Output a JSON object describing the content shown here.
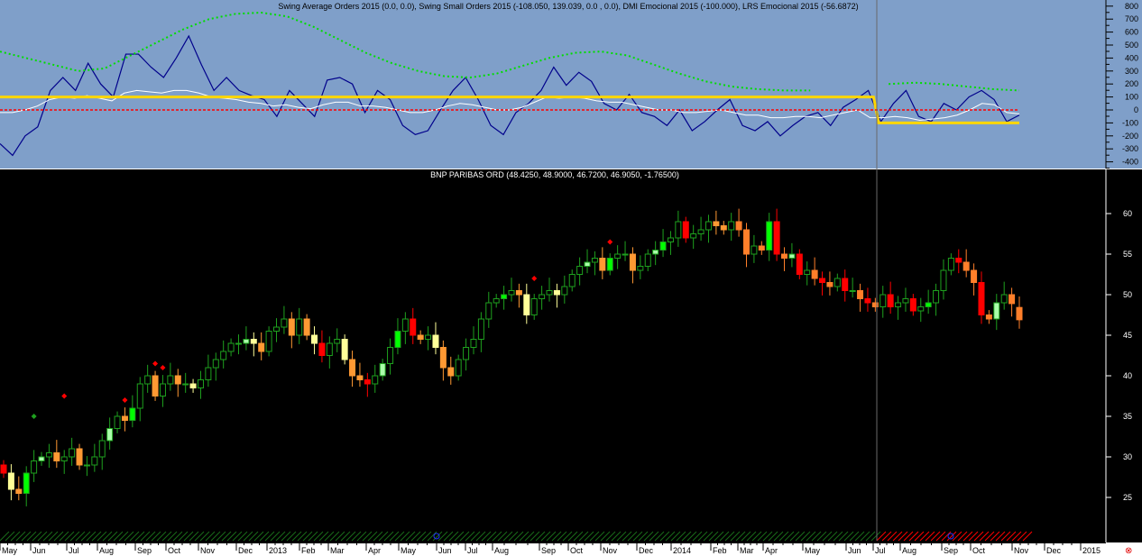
{
  "indicator_pane": {
    "title": "Swing Average Orders 2015 (0.0, 0.0), Swing Small Orders 2015 (-108.050, 139.039, 0.0 , 0.0), DMI Emocional 2015 (-100.000), LRS Emocional 2015 (-56.6872)",
    "y_ticks": [
      "800",
      "700",
      "600",
      "500",
      "400",
      "300",
      "200",
      "100",
      "0",
      "-100",
      "-200",
      "-300",
      "-400"
    ],
    "colors": {
      "background": "#7f9fc9",
      "blue": "#00008b",
      "white": "#ffffff",
      "green": "#00dd00",
      "yellow": "#ffd700",
      "red": "#ff0000"
    }
  },
  "price_pane": {
    "title": "BNP PARIBAS ORD (48.4250, 48.9000, 46.7200, 46.9050, -1.76500)",
    "y_ticks": [
      "60",
      "55",
      "50",
      "45",
      "40",
      "35",
      "30",
      "25"
    ]
  },
  "time_axis": {
    "labels": [
      "May",
      "Jun",
      "Jul",
      "Aug",
      "Sep",
      "Oct",
      "Nov",
      "Dec",
      "2013",
      "Feb",
      "Mar",
      "Apr",
      "May",
      "Jun",
      "Jul",
      "Aug",
      "Sep",
      "Oct",
      "Nov",
      "Dec",
      "2014",
      "Feb",
      "Mar",
      "Apr",
      "May",
      "Jun",
      "Jul",
      "Aug",
      "Sep",
      "Oct",
      "Nov",
      "Dec",
      "2015"
    ]
  },
  "corner_icon": "close-circle-icon",
  "chart_data": [
    {
      "type": "candlestick",
      "title": "BNP PARIBAS ORD",
      "period": "weekly",
      "ylim": [
        21,
        64
      ],
      "closes": [
        28,
        26,
        25.5,
        28,
        29.5,
        30,
        30.5,
        29.5,
        30,
        31,
        29,
        29,
        30,
        32,
        33.5,
        35,
        34.5,
        36,
        39,
        40,
        37.5,
        39,
        40,
        39,
        39,
        38.5,
        39.5,
        41,
        42,
        43,
        44,
        44,
        44.5,
        44,
        43,
        45.5,
        46,
        47,
        45,
        47,
        45,
        44,
        42.5,
        44,
        44.5,
        42,
        40,
        39.5,
        39,
        40,
        41.5,
        43.5,
        45.5,
        47,
        45,
        44.5,
        45,
        43.5,
        41,
        40,
        42,
        43.5,
        44.5,
        47,
        49,
        49.5,
        50,
        50.5,
        50,
        47.5,
        49.5,
        50,
        50.5,
        50,
        51,
        52.5,
        53.5,
        54,
        54.5,
        53,
        54.5,
        55,
        55,
        53,
        53.5,
        55,
        55.5,
        56.5,
        57,
        59,
        57,
        57.5,
        58,
        59,
        58.5,
        58,
        59,
        58,
        55,
        56,
        55.5,
        59,
        55,
        54.5,
        55,
        52.5,
        53,
        52,
        51.5,
        51,
        52,
        50.5,
        50.5,
        49.5,
        49,
        48.5,
        50,
        48.5,
        49,
        49.5,
        48,
        48.5,
        49,
        50.5,
        53,
        54.5,
        54,
        53,
        51.5,
        47.5,
        47,
        49,
        50,
        48.9,
        46.905
      ],
      "last_bar": {
        "open": 48.425,
        "high": 48.9,
        "low": 46.72,
        "close": 46.905,
        "change": -1.765
      }
    },
    {
      "type": "line",
      "title": "Indicators",
      "ylim": [
        -450,
        850
      ],
      "series": [
        {
          "name": "Swing Small Orders",
          "color": "#00008b",
          "values": [
            -260,
            -350,
            -200,
            -130,
            150,
            250,
            150,
            360,
            200,
            100,
            430,
            430,
            330,
            250,
            400,
            570,
            350,
            150,
            250,
            150,
            110,
            80,
            -50,
            150,
            50,
            -50,
            230,
            250,
            200,
            -20,
            150,
            80,
            -120,
            -190,
            -160,
            0,
            150,
            250,
            80,
            -120,
            -190,
            -20,
            50,
            150,
            330,
            190,
            290,
            220,
            50,
            0,
            120,
            -20,
            -50,
            -120,
            0,
            -160,
            -90,
            0,
            80,
            -120,
            -160,
            -90,
            -200,
            -120,
            -50,
            -20,
            -120,
            20,
            80,
            150,
            -90,
            50,
            150,
            -50,
            -90,
            50,
            0,
            100,
            150,
            80,
            -90,
            -40
          ]
        },
        {
          "name": "Swing Average Orders",
          "color": "#ffffff",
          "values": [
            -20,
            -20,
            0,
            30,
            80,
            100,
            90,
            110,
            90,
            70,
            130,
            150,
            140,
            130,
            150,
            150,
            130,
            100,
            90,
            80,
            60,
            50,
            30,
            40,
            20,
            10,
            40,
            60,
            60,
            30,
            30,
            20,
            0,
            -20,
            -20,
            0,
            30,
            50,
            40,
            20,
            0,
            0,
            20,
            60,
            100,
            90,
            100,
            90,
            70,
            60,
            60,
            40,
            20,
            0,
            0,
            -20,
            -20,
            -10,
            0,
            -20,
            -40,
            -40,
            -60,
            -60,
            -50,
            -50,
            -60,
            -40,
            -20,
            0,
            -60,
            -60,
            -50,
            -60,
            -80,
            -70,
            -60,
            -40,
            0,
            50,
            40,
            -20,
            -30
          ]
        },
        {
          "name": "Green dotted",
          "color": "#00dd00",
          "values": [
            450,
            400,
            350,
            300,
            320,
            420,
            520,
            620,
            700,
            740,
            750,
            720,
            640,
            540,
            440,
            360,
            300,
            260,
            250,
            280,
            340,
            400,
            440,
            450,
            420,
            350,
            280,
            220,
            180,
            160,
            150,
            150,
            null,
            null,
            200,
            210,
            200,
            180,
            160,
            150
          ]
        },
        {
          "name": "DMI Emocional",
          "color": "#ffd700",
          "step": [
            [
              0,
              100
            ],
            [
              0.857,
              100
            ],
            [
              0.862,
              -100
            ],
            [
              1,
              -100
            ]
          ]
        },
        {
          "name": "Zero",
          "color": "#ff0000",
          "values": [
            0,
            0
          ]
        }
      ]
    }
  ]
}
